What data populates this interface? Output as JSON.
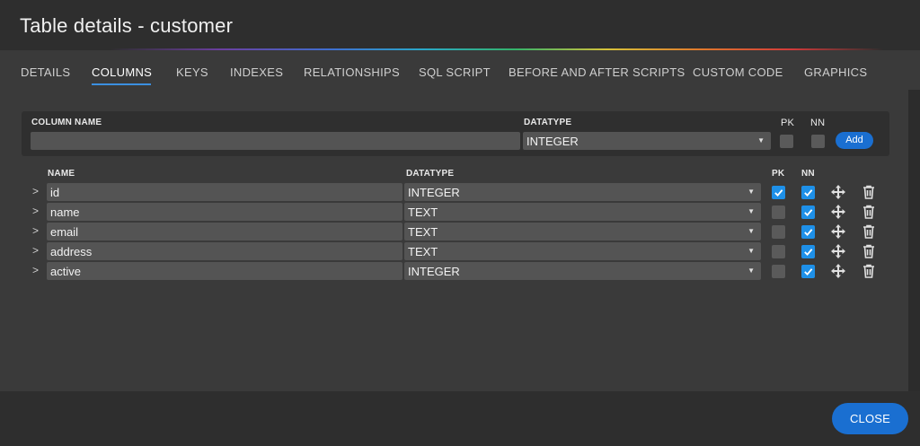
{
  "window": {
    "title": "Table details - customer"
  },
  "tabs": [
    {
      "label": "DETAILS"
    },
    {
      "label": "COLUMNS",
      "active": true
    },
    {
      "label": "KEYS"
    },
    {
      "label": "INDEXES"
    },
    {
      "label": "RELATIONSHIPS"
    },
    {
      "label": "SQL SCRIPT"
    },
    {
      "label": "BEFORE AND AFTER SCRIPTS"
    },
    {
      "label": "CUSTOM CODE"
    },
    {
      "label": "GRAPHICS"
    }
  ],
  "new_column": {
    "column_name_label": "COLUMN NAME",
    "column_name_value": "",
    "datatype_label": "DATATYPE",
    "datatype_value": "INTEGER",
    "pk_label": "PK",
    "nn_label": "NN",
    "pk_checked": false,
    "nn_checked": false,
    "add_label": "Add"
  },
  "columns_header": {
    "name_label": "NAME",
    "datatype_label": "DATATYPE",
    "pk_label": "PK",
    "nn_label": "NN"
  },
  "columns": [
    {
      "name": "id",
      "datatype": "INTEGER",
      "pk": true,
      "nn": true
    },
    {
      "name": "name",
      "datatype": "TEXT",
      "pk": false,
      "nn": true
    },
    {
      "name": "email",
      "datatype": "TEXT",
      "pk": false,
      "nn": true
    },
    {
      "name": "address",
      "datatype": "TEXT",
      "pk": false,
      "nn": true
    },
    {
      "name": "active",
      "datatype": "INTEGER",
      "pk": false,
      "nn": true
    }
  ],
  "icons": {
    "expand": "chevron-right-icon",
    "dropdown": "caret-down-icon",
    "move": "move-arrows-icon",
    "delete": "trash-icon",
    "check": "checkmark-icon"
  },
  "colors": {
    "accent": "#1a6fd1",
    "checkbox_on": "#1e90e8",
    "tab_underline": "#3b8fe0"
  },
  "footer": {
    "close_label": "CLOSE"
  }
}
